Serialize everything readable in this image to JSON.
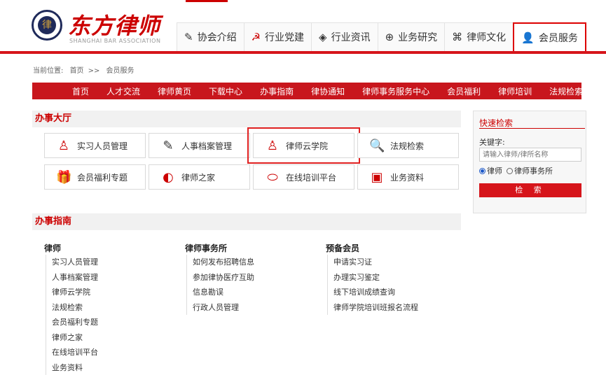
{
  "header": {
    "seal_mark": "律",
    "brand": "东方律师",
    "brand_sub": "SHANGHAI BAR ASSOCIATION",
    "nav": [
      {
        "icon": "edit-icon",
        "glyph": "✎",
        "label": "协会介绍"
      },
      {
        "icon": "party-emblem-icon",
        "glyph": "☭",
        "label": "行业党建"
      },
      {
        "icon": "tag-icon",
        "glyph": "◈",
        "label": "行业资讯"
      },
      {
        "icon": "globe-icon",
        "glyph": "⊕",
        "label": "业务研究"
      },
      {
        "icon": "command-icon",
        "glyph": "⌘",
        "label": "律师文化"
      },
      {
        "icon": "user-icon",
        "glyph": "👤",
        "label": "会员服务",
        "selected": true
      }
    ]
  },
  "breadcrumb": {
    "prefix": "当前位置:",
    "home": "首页",
    "sep": ">>",
    "current": "会员服务"
  },
  "subnav": [
    "首页",
    "人才交流",
    "律师黄页",
    "下载中心",
    "办事指南",
    "律协通知",
    "律师事务服务中心",
    "会员福利",
    "律师培训",
    "法规检索"
  ],
  "hall": {
    "title": "办事大厅",
    "buttons": [
      {
        "icon": "person-icon",
        "glyph": "♙",
        "label": "实习人员管理"
      },
      {
        "icon": "edit-icon",
        "glyph": "✎",
        "label": "人事档案管理"
      },
      {
        "icon": "person-icon",
        "glyph": "♙",
        "label": "律师云学院",
        "highlighted": true
      },
      {
        "icon": "search-icon",
        "glyph": "🔍",
        "label": "法规检索"
      },
      {
        "icon": "gift-icon",
        "glyph": "🎁",
        "label": "会员福利专题"
      },
      {
        "icon": "home-icon",
        "glyph": "◐",
        "label": "律师之家"
      },
      {
        "icon": "pill-icon",
        "glyph": "⬭",
        "label": "在线培训平台"
      },
      {
        "icon": "box-icon",
        "glyph": "▣",
        "label": "业务资料"
      }
    ]
  },
  "quick_search": {
    "title": "快速检索",
    "keyword_label": "关键字:",
    "placeholder": "请输入律师/律所名称",
    "radio1": "律师",
    "radio2": "律师事务所",
    "radio_selected": "律师",
    "button": "检 索"
  },
  "guide": {
    "title": "办事指南",
    "columns": [
      {
        "title": "律师",
        "items": [
          "实习人员管理",
          "人事档案管理",
          "律师云学院",
          "法规检索",
          "会员福利专题",
          "律师之家",
          "在线培训平台",
          "业务资料"
        ]
      },
      {
        "title": "律师事务所",
        "items": [
          "如何发布招聘信息",
          "参加律协医疗互助",
          "信息勘误",
          "行政人员管理"
        ]
      },
      {
        "title": "预备会员",
        "items": [
          "申请实习证",
          "办理实习鉴定",
          "线下培训成绩查询",
          "律师学院培训班报名流程"
        ]
      }
    ]
  }
}
